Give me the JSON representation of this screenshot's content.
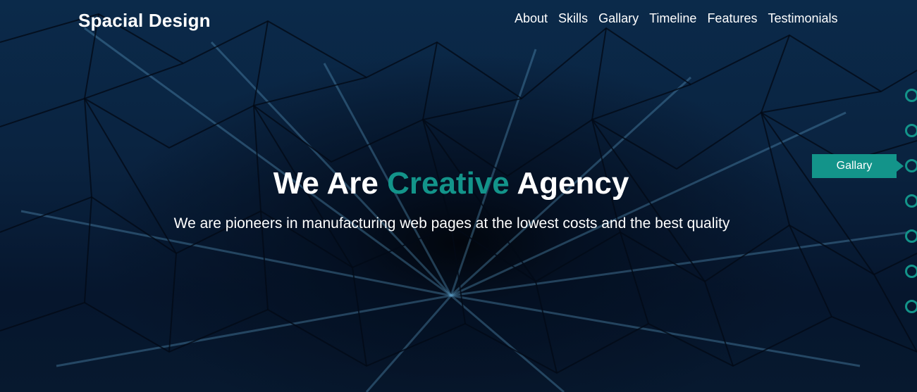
{
  "header": {
    "logo": "Spacial Design",
    "nav": [
      "About",
      "Skills",
      "Gallary",
      "Timeline",
      "Features",
      "Testimonials"
    ]
  },
  "hero": {
    "title_before": "We Are",
    "title_accent": "Creative",
    "title_after": "Agency",
    "subtitle": "We are pioneers in manufacturing web pages at the lowest costs and the best quality"
  },
  "side_nav": {
    "tooltip": "Gallary",
    "active_index": 2,
    "bullet_count": 7
  },
  "colors": {
    "accent": "#13948a",
    "background": "#07162b",
    "text": "#ffffff"
  }
}
